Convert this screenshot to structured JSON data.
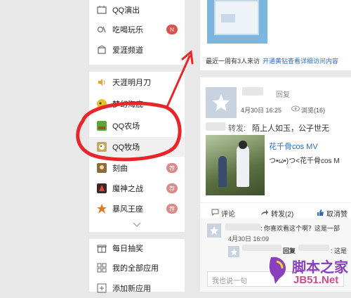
{
  "sidebar": {
    "top_items": [
      {
        "label": "QQ演出",
        "icon": "ticket-icon"
      },
      {
        "label": "吃喝玩乐",
        "icon": "food-icon",
        "badge": "N",
        "badge_color": "#d9534f"
      },
      {
        "label": "爱涯频道",
        "icon": "box-icon"
      }
    ],
    "game_items": [
      {
        "label": "天涯明月刀",
        "icon": "game-sound-icon"
      },
      {
        "label": "梦幻海底",
        "icon": "fish-game-icon"
      },
      {
        "label": "QQ农场",
        "icon": "farm-icon"
      },
      {
        "label": "QQ牧场",
        "icon": "ranch-icon"
      },
      {
        "label": "刻曲",
        "icon": "game-icon-1",
        "badge": "荐",
        "badge_color": "#d98b87"
      },
      {
        "label": "魔神之战",
        "icon": "game-icon-2",
        "badge": "荐",
        "badge_color": "#d98b87"
      },
      {
        "label": "暴风王座",
        "icon": "game-icon-3",
        "badge": "荐",
        "badge_color": "#d98b87"
      }
    ],
    "bottom_items": [
      {
        "label": "每日抽奖",
        "icon": "gift-icon"
      },
      {
        "label": "我的全部应用",
        "icon": "grid-icon"
      },
      {
        "label": "添加新应用",
        "icon": "add-icon"
      }
    ]
  },
  "visitors": {
    "text": "最近一周有3人来访",
    "link": "开通黄钻查看详细访问内容"
  },
  "post": {
    "title_suffix": "回复",
    "date": "4月30日 16:25",
    "views": "浏览(16)",
    "forward_label": "转发:",
    "forward_text": "陌上人如玉，公子世无",
    "media_title": "花千骨cos MV",
    "media_desc": "つ•ω•)つ<花千骨cos M",
    "actions": {
      "comment": "评论",
      "repost": "转发(2)",
      "like": "取消赞"
    }
  },
  "comments": [
    {
      "text": ": 你喜欢看这个啊？这是一部",
      "date": "4月30日 16:09"
    },
    {
      "prefix": "回复",
      "text": ": 这是"
    }
  ],
  "reply_placeholder": "我也说一句",
  "watermark": {
    "title": "脚本之家",
    "url": "JB51.Net"
  },
  "colors": {
    "annotation_red": "#e8262a",
    "link_blue": "#2a6ebb",
    "badge_red": "#d9534f"
  }
}
